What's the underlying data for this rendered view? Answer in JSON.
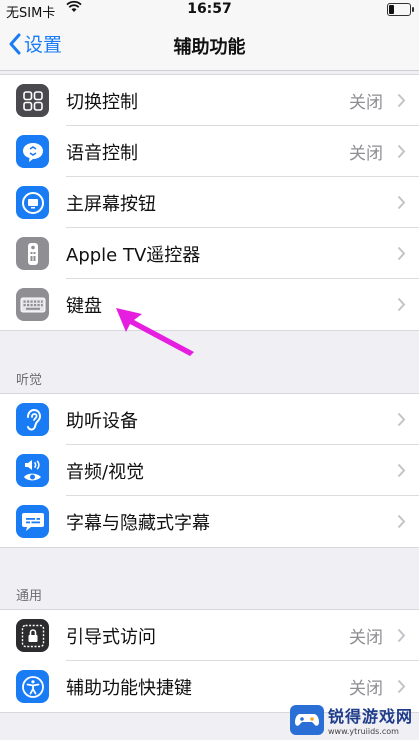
{
  "status": {
    "carrier": "无SIM卡",
    "time": "16:57"
  },
  "nav": {
    "back_label": "设置",
    "title": "辅助功能"
  },
  "group1": [
    {
      "label": "切换控制",
      "value": "关闭",
      "icon": "switch-control-icon",
      "color": "#4a4a4e"
    },
    {
      "label": "语音控制",
      "value": "关闭",
      "icon": "voice-control-icon",
      "color": "#1a7cf5"
    },
    {
      "label": "主屏幕按钮",
      "value": "",
      "icon": "home-button-icon",
      "color": "#1a7cf5"
    },
    {
      "label": "Apple TV遥控器",
      "value": "",
      "icon": "tv-remote-icon",
      "color": "#8e8e93"
    },
    {
      "label": "键盘",
      "value": "",
      "icon": "keyboard-icon",
      "color": "#8e8e93"
    }
  ],
  "hearing": {
    "header": "听觉",
    "items": [
      {
        "label": "助听设备",
        "value": "",
        "icon": "hearing-ear-icon",
        "color": "#1a7cf5"
      },
      {
        "label": "音频/视觉",
        "value": "",
        "icon": "audio-visual-icon",
        "color": "#1a7cf5"
      },
      {
        "label": "字幕与隐藏式字幕",
        "value": "",
        "icon": "subtitles-icon",
        "color": "#1a7cf5"
      }
    ]
  },
  "general": {
    "header": "通用",
    "items": [
      {
        "label": "引导式访问",
        "value": "关闭",
        "icon": "guided-access-icon",
        "color": "#2c2c2e"
      },
      {
        "label": "辅助功能快捷键",
        "value": "关闭",
        "icon": "accessibility-shortcut-icon",
        "color": "#1a7cf5"
      }
    ]
  },
  "watermark": {
    "name": "锐得游戏网",
    "url": "www.ytruiids.com"
  },
  "annotation_color": "#e61ee0"
}
